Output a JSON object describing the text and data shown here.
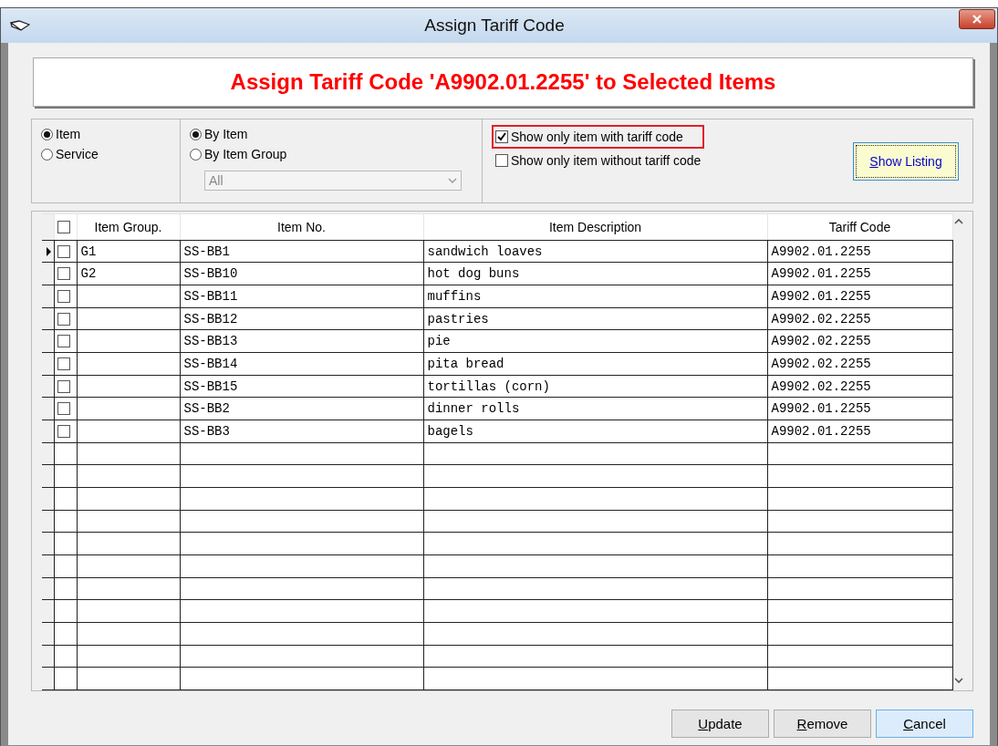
{
  "window": {
    "title": "Assign Tariff Code"
  },
  "banner": {
    "text": "Assign Tariff Code 'A9902.01.2255' to Selected Items"
  },
  "type_options": [
    {
      "label": "Item",
      "selected": true
    },
    {
      "label": "Service",
      "selected": false
    }
  ],
  "filter_options": [
    {
      "label": "By Item",
      "selected": true
    },
    {
      "label": "By Item Group",
      "selected": false
    }
  ],
  "group_dropdown": {
    "value": "All",
    "disabled": true
  },
  "show_options": [
    {
      "label": "Show only item with tariff code",
      "checked": true,
      "highlighted": true
    },
    {
      "label": "Show only item without tariff code",
      "checked": false,
      "highlighted": false
    }
  ],
  "show_listing_button": {
    "label": "Show Listing",
    "focused": true
  },
  "table": {
    "select_all_checked": false,
    "columns": [
      "Item Group.",
      "Item No.",
      "Item Description",
      "Tariff Code"
    ],
    "rows": [
      {
        "current": true,
        "checked": false,
        "cells": [
          "G1",
          "SS-BB1",
          "sandwich loaves",
          "A9902.01.2255"
        ]
      },
      {
        "current": false,
        "checked": false,
        "cells": [
          "G2",
          "SS-BB10",
          "hot dog buns",
          "A9902.01.2255"
        ]
      },
      {
        "current": false,
        "checked": false,
        "cells": [
          "",
          "SS-BB11",
          "muffins",
          "A9902.01.2255"
        ]
      },
      {
        "current": false,
        "checked": false,
        "cells": [
          "",
          "SS-BB12",
          "pastries",
          "A9902.02.2255"
        ]
      },
      {
        "current": false,
        "checked": false,
        "cells": [
          "",
          "SS-BB13",
          "pie",
          "A9902.02.2255"
        ]
      },
      {
        "current": false,
        "checked": false,
        "cells": [
          "",
          "SS-BB14",
          "pita bread",
          "A9902.02.2255"
        ]
      },
      {
        "current": false,
        "checked": false,
        "cells": [
          "",
          "SS-BB15",
          "tortillas (corn)",
          "A9902.02.2255"
        ]
      },
      {
        "current": false,
        "checked": false,
        "cells": [
          "",
          "SS-BB2",
          "dinner rolls",
          "A9902.01.2255"
        ]
      },
      {
        "current": false,
        "checked": false,
        "cells": [
          "",
          "SS-BB3",
          "bagels",
          "A9902.01.2255"
        ]
      }
    ]
  },
  "buttons": [
    {
      "label": "Update",
      "default": false
    },
    {
      "label": "Remove",
      "default": false
    },
    {
      "label": "Cancel",
      "default": true
    }
  ]
}
